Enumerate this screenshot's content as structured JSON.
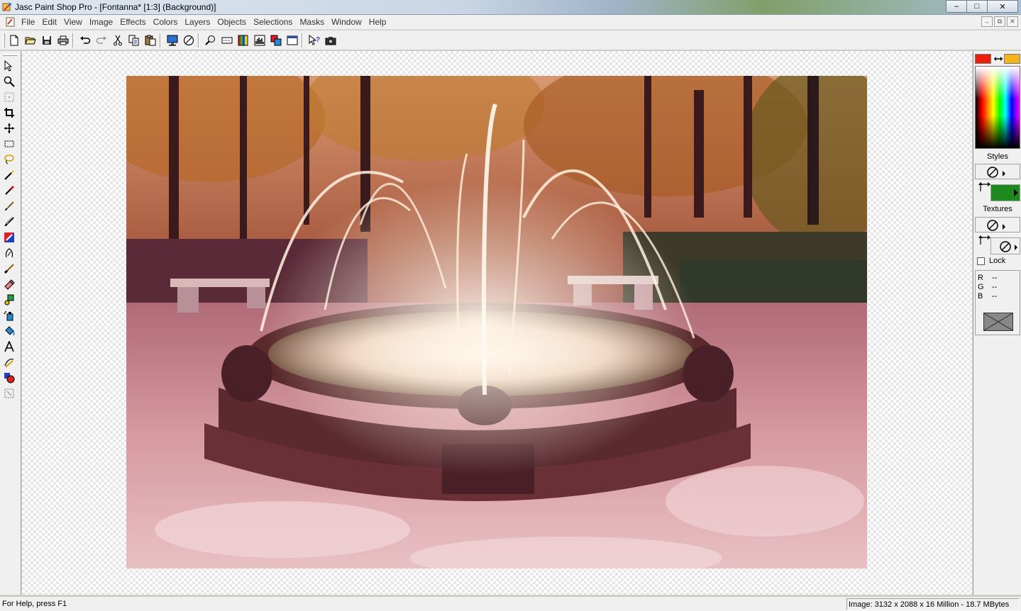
{
  "window": {
    "title": "Jasc Paint Shop Pro - [Fontanna* [1:3] (Background)]",
    "minimize": "–",
    "maximize": "□",
    "close": "✕"
  },
  "menu": {
    "items": [
      "File",
      "Edit",
      "View",
      "Image",
      "Effects",
      "Colors",
      "Layers",
      "Objects",
      "Selections",
      "Masks",
      "Window",
      "Help"
    ],
    "mdi_minimize": "–",
    "mdi_restore": "⧉",
    "mdi_close": "✕"
  },
  "toolbar": {
    "icons": [
      "new-icon",
      "open-icon",
      "save-icon",
      "print-icon",
      "undo-icon",
      "redo-icon",
      "cut-icon",
      "copy-icon",
      "paste-icon",
      "full-screen-preview-icon",
      "normal-viewing-icon",
      "overview-icon",
      "toolbar-icon",
      "color-palette-icon",
      "histogram-icon",
      "layer-palette-icon",
      "learning-center-icon",
      "help-icon",
      "camera-icon"
    ]
  },
  "tools": {
    "icons": [
      "arrow-icon",
      "zoom-icon",
      "deform-icon",
      "crop-icon",
      "mover-icon",
      "selection-icon",
      "freehand-icon",
      "magic-wand-icon",
      "dropper-icon",
      "paint-brush-icon",
      "clone-brush-icon",
      "color-replacer-icon",
      "retouch-icon",
      "scratch-remover-icon",
      "eraser-icon",
      "picture-tube-icon",
      "airbrush-icon",
      "flood-fill-icon",
      "text-icon",
      "draw-icon",
      "preset-shapes-icon",
      "object-selector-icon"
    ]
  },
  "color_panel": {
    "foreground_color": "#ee1c0a",
    "background_color": "#f4b41a",
    "styles_label": "Styles",
    "textures_label": "Textures",
    "lock_label": "Lock",
    "lock_checked": false,
    "rgb": [
      {
        "label": "R",
        "value": "--"
      },
      {
        "label": "G",
        "value": "--"
      },
      {
        "label": "B",
        "value": "--"
      }
    ],
    "style_fill_color": "#1c8a1c"
  },
  "status": {
    "help_text": "For Help, press F1",
    "image_info": "Image:  3132 x 2088 x 16 Million - 18.7 MBytes"
  }
}
